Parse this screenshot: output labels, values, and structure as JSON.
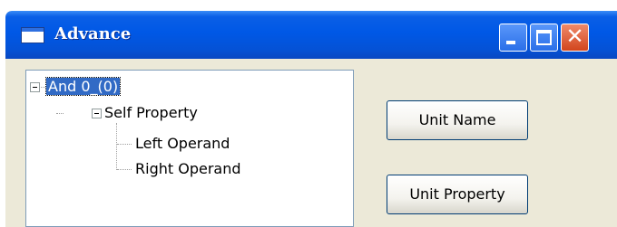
{
  "window": {
    "title": "Advance",
    "controls": [
      "minimize",
      "maximize",
      "close"
    ]
  },
  "tree": {
    "nodes": [
      {
        "label": "And 0_(0)",
        "expanded": true,
        "selected": true,
        "level": 0
      },
      {
        "label": "Self Property",
        "expanded": true,
        "selected": false,
        "level": 1
      },
      {
        "label": "Left Operand",
        "selected": false,
        "level": 2
      },
      {
        "label": "Right Operand",
        "selected": false,
        "level": 2
      }
    ]
  },
  "buttons": {
    "unit_name": "Unit Name",
    "unit_property": "Unit Property"
  },
  "colors": {
    "titlebar": "#0058e6",
    "selection": "#316ac5",
    "close_button": "#d2451d",
    "dialog_background": "#ece9d8"
  }
}
